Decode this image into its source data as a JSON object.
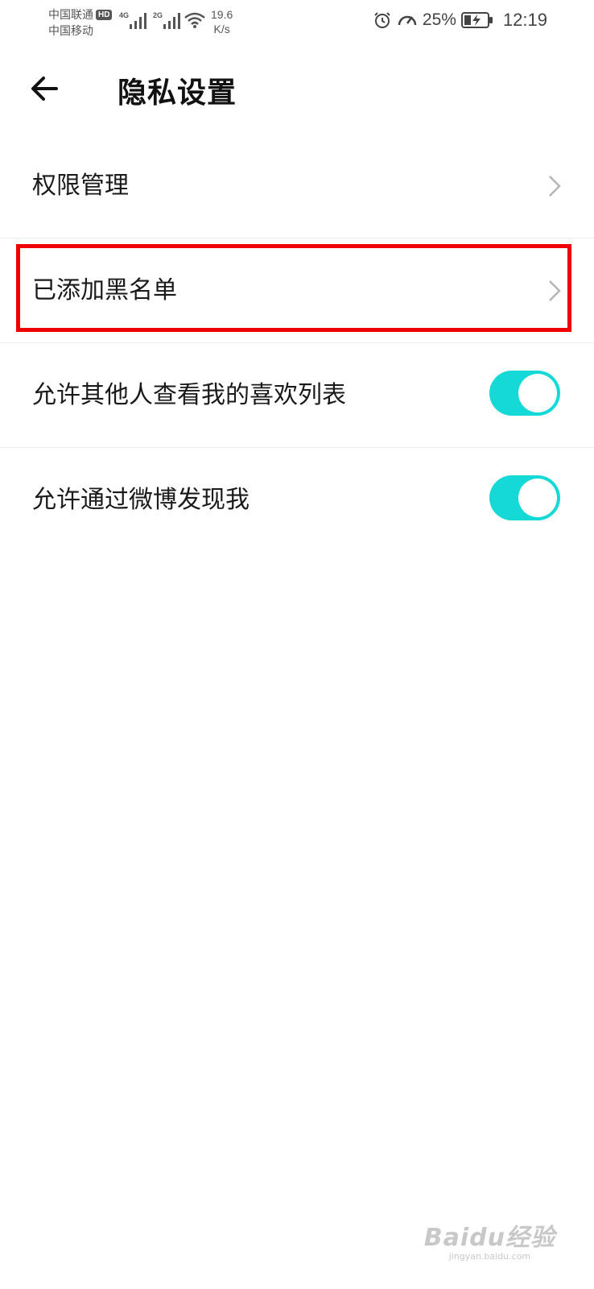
{
  "status_bar": {
    "carrier_1": "中国联通",
    "carrier_1_badge": "HD",
    "carrier_2": "中国移动",
    "sim1_network": "4G",
    "sim2_network": "2G",
    "net_speed_value": "19.6",
    "net_speed_unit": "K/s",
    "battery_percent": "25%",
    "time": "12:19",
    "icons": [
      "signal-icon",
      "wifi-icon",
      "alarm-icon",
      "speed-boost-icon",
      "battery-charging-icon"
    ]
  },
  "header": {
    "back_icon": "arrow-left-icon",
    "title": "隐私设置"
  },
  "settings": {
    "items": [
      {
        "label": "权限管理",
        "control": "chevron"
      },
      {
        "label": "已添加黑名单",
        "control": "chevron",
        "highlighted": true
      },
      {
        "label": "允许其他人查看我的喜欢列表",
        "control": "toggle",
        "on": true
      },
      {
        "label": "允许通过微博发现我",
        "control": "toggle",
        "on": true
      }
    ]
  },
  "colors": {
    "toggle_on": "#14d9d6",
    "highlight_border": "#ee0000",
    "divider": "#ececec"
  },
  "watermark": {
    "logo": "Baidu经验",
    "url": "jingyan.baidu.com"
  }
}
